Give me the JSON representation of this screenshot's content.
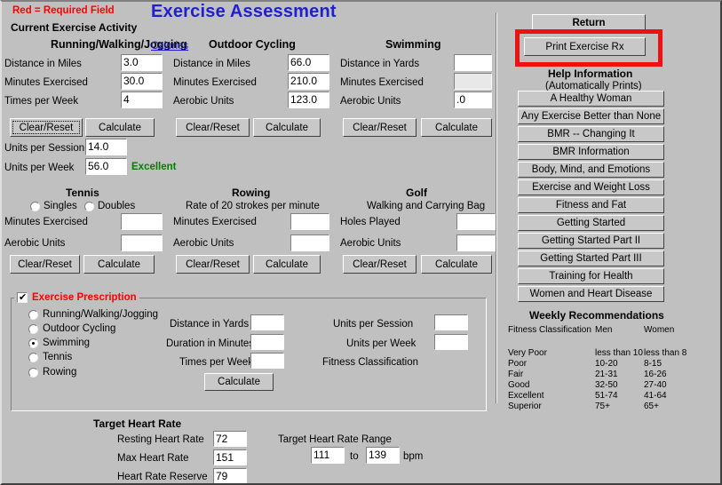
{
  "window": {
    "title": "Exercise Assessment",
    "required_note": "Red = Required Field",
    "section_heading": "Current Exercise Activity"
  },
  "activities": {
    "running": {
      "title": "Running/Walking/Jogging",
      "calories_link": "Calories",
      "fields": [
        {
          "label": "Distance in Miles",
          "value": "3.0"
        },
        {
          "label": "Minutes Exercised",
          "value": "30.0"
        },
        {
          "label": "Times per Week",
          "value": "4"
        }
      ],
      "clear_label": "Clear/Reset",
      "calculate_label": "Calculate",
      "results": [
        {
          "label": "Units per Session",
          "value": "14.0"
        },
        {
          "label": "Units per Week",
          "value": "56.0"
        }
      ],
      "classification": "Excellent"
    },
    "cycling": {
      "title": "Outdoor Cycling",
      "fields": [
        {
          "label": "Distance in Miles",
          "value": "66.0"
        },
        {
          "label": "Minutes Exercised",
          "value": "210.0"
        },
        {
          "label": "Aerobic Units",
          "value": "123.0"
        }
      ],
      "clear_label": "Clear/Reset",
      "calculate_label": "Calculate"
    },
    "swimming": {
      "title": "Swimming",
      "fields": [
        {
          "label": "Distance in Yards",
          "value": ""
        },
        {
          "label": "Minutes Exercised",
          "value": ""
        },
        {
          "label": "Aerobic Units",
          "value": ".0"
        }
      ],
      "clear_label": "Clear/Reset",
      "calculate_label": "Calculate"
    },
    "tennis": {
      "title": "Tennis",
      "singles_label": "Singles",
      "doubles_label": "Doubles",
      "fields": [
        {
          "label": "Minutes Exercised",
          "value": ""
        },
        {
          "label": "Aerobic Units",
          "value": ""
        }
      ],
      "clear_label": "Clear/Reset",
      "calculate_label": "Calculate"
    },
    "rowing": {
      "title": "Rowing",
      "subtitle": "Rate of 20 strokes per minute",
      "fields": [
        {
          "label": "Minutes Exercised",
          "value": ""
        },
        {
          "label": "Aerobic Units",
          "value": ""
        }
      ],
      "clear_label": "Clear/Reset",
      "calculate_label": "Calculate"
    },
    "golf": {
      "title": "Golf",
      "subtitle": "Walking and Carrying Bag",
      "fields": [
        {
          "label": "Holes Played",
          "value": ""
        },
        {
          "label": "Aerobic Units",
          "value": ""
        }
      ],
      "clear_label": "Clear/Reset",
      "calculate_label": "Calculate"
    }
  },
  "prescription": {
    "group_title": "Exercise Prescription",
    "checked": true,
    "options": [
      {
        "label": "Running/Walking/Jogging",
        "selected": false
      },
      {
        "label": "Outdoor Cycling",
        "selected": false
      },
      {
        "label": "Swimming",
        "selected": true
      },
      {
        "label": "Tennis",
        "selected": false
      },
      {
        "label": "Rowing",
        "selected": false
      }
    ],
    "inputs": [
      {
        "label": "Distance in Yards",
        "value": ""
      },
      {
        "label": "Duration in Minutes",
        "value": ""
      },
      {
        "label": "Times per Week",
        "value": ""
      }
    ],
    "outputs": [
      {
        "label": "Units per Session",
        "value": ""
      },
      {
        "label": "Units per Week",
        "value": ""
      }
    ],
    "fitness_classification_label": "Fitness Classification",
    "fitness_classification_value": "",
    "calculate_label": "Calculate"
  },
  "heart_rate": {
    "title": "Target Heart Rate",
    "fields": [
      {
        "label": "Resting Heart Rate",
        "value": "72"
      },
      {
        "label": "Max Heart Rate",
        "value": "151"
      },
      {
        "label": "Heart Rate Reserve",
        "value": "79"
      }
    ],
    "range_title": "Target Heart Rate Range",
    "range_low": "111",
    "range_to": "to",
    "range_high": "139",
    "range_unit": "bpm"
  },
  "sidebar": {
    "return_label": "Return",
    "print_label": "Print Exercise Rx",
    "help_heading": "Help Information",
    "help_subheading": "(Automatically Prints)",
    "help_buttons": [
      "A Healthy Woman",
      "Any Exercise Better than None",
      "BMR -- Changing It",
      "BMR Information",
      "Body, Mind, and Emotions",
      "Exercise and Weight Loss",
      "Fitness and Fat",
      "Getting Started",
      "Getting Started Part II",
      "Getting Started Part III",
      "Training for Health",
      "Women and Heart Disease"
    ]
  },
  "weekly_recommendations": {
    "title": "Weekly Recommendations",
    "columns": [
      "Fitness Classification",
      "Men",
      "Women"
    ],
    "rows": [
      [
        "Very Poor",
        "less than 10",
        "less than 8"
      ],
      [
        "Poor",
        "10-20",
        "8-15"
      ],
      [
        "Fair",
        "21-31",
        "16-26"
      ],
      [
        "Good",
        "32-50",
        "27-40"
      ],
      [
        "Excellent",
        "51-74",
        "41-64"
      ],
      [
        "Superior",
        "75+",
        "65+"
      ]
    ]
  },
  "colors": {
    "accent_title": "#2020d0",
    "required_red": "#ff0000",
    "highlight_red": "#ee1111",
    "good_green": "#008000",
    "link_blue": "#1a1ad0",
    "face": "#c0c0c0"
  }
}
